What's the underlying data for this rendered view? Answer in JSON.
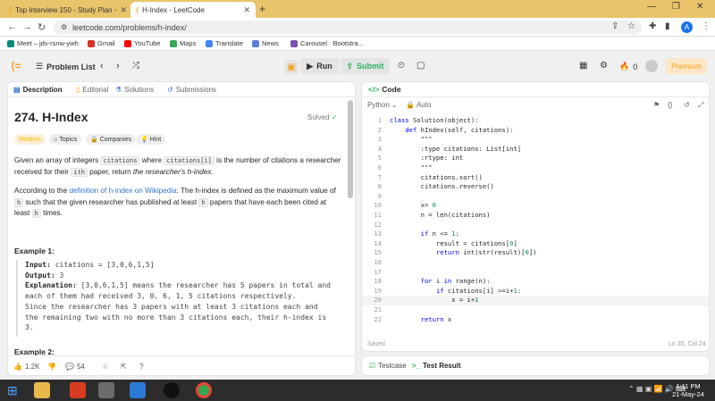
{
  "browser": {
    "tabs": [
      {
        "label": "Top Interview 150 - Study Plan - ",
        "active": false
      },
      {
        "label": "H-Index - LeetCode",
        "active": true
      }
    ],
    "url": "leetcode.com/problems/h-index/",
    "profile_initial": "A",
    "bookmarks": [
      "Meet – jdv-rsnw-ywh",
      "Gmail",
      "YouTube",
      "Maps",
      "Translate",
      "News",
      "Carousel · Bootstra..."
    ]
  },
  "header": {
    "problem_list": "Problem List",
    "run": "Run",
    "submit": "Submit",
    "streak": "0",
    "premium": "Premium"
  },
  "description": {
    "tabs": [
      "Description",
      "Editorial",
      "Solutions",
      "Submissions"
    ],
    "title": "274. H-Index",
    "solved": "Solved",
    "tags": [
      "Medium",
      "Topics",
      "Companies",
      "Hint"
    ],
    "p1_a": "Given an array of integers ",
    "p1_code1": "citations",
    "p1_b": " where ",
    "p1_code2": "citations[i]",
    "p1_c": " is the number of citations a researcher received for their ",
    "p1_sup": "ith",
    "p1_d": " paper, return ",
    "p1_em": "the researcher's h-index",
    "p1_e": ".",
    "p2_a": "According to the ",
    "p2_link": "definition of h-index on Wikipedia",
    "p2_b": ": The h-index is defined as the maximum value of ",
    "p2_code1": "h",
    "p2_c": " such that the given researcher has published at least ",
    "p2_code2": "h",
    "p2_d": " papers that have each been cited at least ",
    "p2_code3": "h",
    "p2_e": " times.",
    "example1_title": "Example 1:",
    "input_label": "Input:",
    "input_value": "citations = [3,0,6,1,5]",
    "output_label": "Output:",
    "output_value": "3",
    "explanation_label": "Explanation:",
    "explanation_lines": [
      "[3,0,6,1,5] means the researcher has 5 papers in total and",
      "each of them had received 3, 0, 6, 1, 5 citations respectively.",
      "Since the researcher has 3 papers with at least 3 citations each and",
      "the remaining two with no more than 3 citations each, their h-index is",
      "3."
    ],
    "example2_title": "Example 2:",
    "likes": "1.2K",
    "comments": "54"
  },
  "editor": {
    "tab": "Code",
    "language": "Python",
    "mode": "Auto",
    "lines": [
      "class Solution(object):",
      "    def hIndex(self, citations):",
      "        \"\"\"",
      "        :type citations: List[int]",
      "        :rtype: int",
      "        \"\"\"",
      "        citations.sort()",
      "        citations.reverse()",
      "",
      "        x= 0",
      "        n = len(citations)",
      "",
      "        if n <= 1:",
      "            result = citations[0]",
      "            return int(str(result)[0])",
      "",
      "",
      "        for i in range(n):",
      "            if citations[i] >=i+1:",
      "                x = i+1",
      "",
      "        return x"
    ],
    "current_line": 20,
    "saved": "Saved",
    "position": "Ln 20, Col 24",
    "testcase": "Testcase",
    "test_result": "Test Result"
  },
  "taskbar": {
    "time": "1:11 PM",
    "date": "21-May-24"
  }
}
